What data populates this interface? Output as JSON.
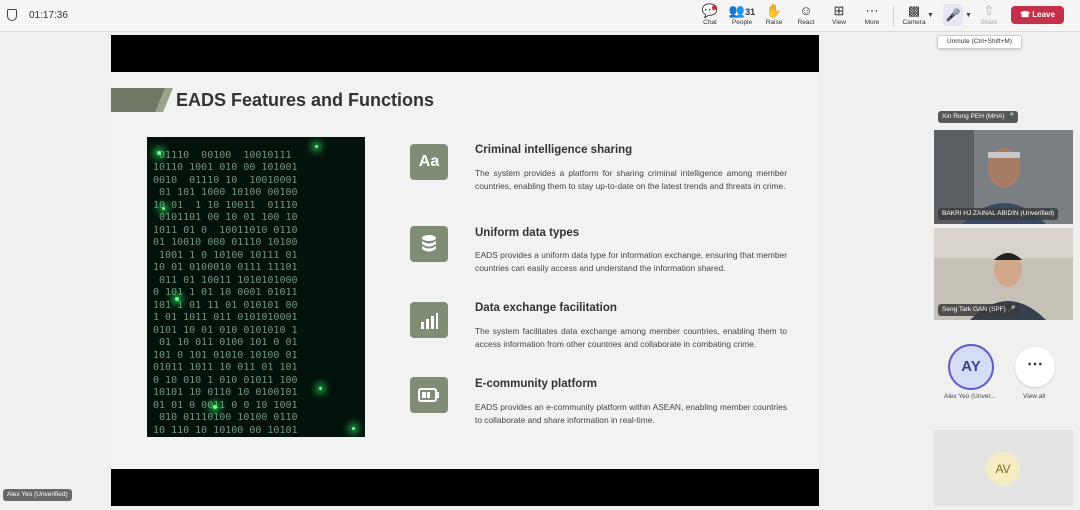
{
  "meeting": {
    "timer": "01:17:36"
  },
  "toolbar": {
    "chat": "Chat",
    "people": "People",
    "people_count": "31",
    "raise": "Raise",
    "react": "React",
    "view": "View",
    "more": "More",
    "camera": "Camera",
    "share": "Share",
    "leave": "Leave",
    "tooltip": "Unmute (Ctrl+Shift+M)"
  },
  "slide": {
    "title": "EADS Features and Functions",
    "features": [
      {
        "title": "Criminal intelligence sharing",
        "icon": "Aa",
        "desc": "The system provides a platform for sharing criminal intelligence among member countries, enabling them to stay up-to-date on the latest trends and threats in crime."
      },
      {
        "title": "Uniform data types",
        "icon": "database-icon",
        "desc": "EADS provides a uniform data type for information exchange, ensuring that member countries can easily access and understand the information shared."
      },
      {
        "title": "Data exchange facilitation",
        "icon": "bar-chart-icon",
        "desc": "The system facilitates data exchange among member countries, enabling them to access information from other countries and collaborate in combating crime."
      },
      {
        "title": "E-community platform",
        "icon": "battery-icon",
        "desc": "EADS provides an e-community platform within ASEAN, enabling member countries to collaborate and share information in real-time."
      }
    ]
  },
  "participants": {
    "top_label": "Xin Rong PEH (MHA)",
    "p1": "BAKRI HJ ZAINAL ABIDIN (Unverified)",
    "p2": "Seng Tark GAN (SPF)",
    "p3_initials": "AY",
    "p3_name": "Alex Yeo (Unver...",
    "view_all": "View all",
    "av_initials": "AV",
    "self_name": "Alex Yeo (Unverified)"
  }
}
